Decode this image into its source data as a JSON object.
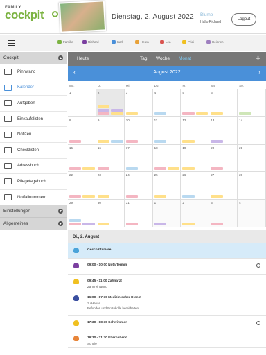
{
  "header": {
    "logo_line1": "FAMILY",
    "logo_line2": "cockpit",
    "date": "Dienstag, 2. August 2022",
    "user_name": "Blume",
    "greeting": "Hallo Richard",
    "logout_label": "Logout"
  },
  "members": [
    {
      "name": "Familie",
      "color": "#7cb342"
    },
    {
      "name": "Richard",
      "color": "#7b3fa0"
    },
    {
      "name": "Karl",
      "color": "#4a90d9"
    },
    {
      "name": "Helen",
      "color": "#e8a23a"
    },
    {
      "name": "Lea",
      "color": "#d9534f"
    },
    {
      "name": "Pridi",
      "color": "#f0c020"
    },
    {
      "name": "Heinrich",
      "color": "#9e7fbf"
    }
  ],
  "sidebar": {
    "section_cockpit": "Cockpit",
    "items": [
      {
        "label": "Pinnwand",
        "icon": "pinboard-icon"
      },
      {
        "label": "Kalender",
        "icon": "calendar-icon"
      },
      {
        "label": "Aufgaben",
        "icon": "tasks-icon"
      },
      {
        "label": "Einkaufslisten",
        "icon": "shopping-icon"
      },
      {
        "label": "Notizen",
        "icon": "notes-icon"
      },
      {
        "label": "Checklisten",
        "icon": "checklist-icon"
      },
      {
        "label": "Adressbuch",
        "icon": "addressbook-icon"
      },
      {
        "label": "Pflegetagebuch",
        "icon": "care-diary-icon"
      },
      {
        "label": "Notfallnummern",
        "icon": "emergency-icon"
      }
    ],
    "section_settings": "Einstellungen",
    "section_general": "Allgemeines"
  },
  "calendar": {
    "today_label": "Heute",
    "tabs": [
      "Tag",
      "Woche",
      "Monat"
    ],
    "active_tab": "Monat",
    "month_title": "August 2022",
    "weekdays": [
      "Mo.",
      "Di.",
      "Mi.",
      "Do.",
      "Fr.",
      "Sa.",
      "So."
    ],
    "weeks": [
      [
        "1",
        "2",
        "3",
        "4",
        "5",
        "6",
        "7"
      ],
      [
        "8",
        "9",
        "10",
        "11",
        "12",
        "13",
        "14"
      ],
      [
        "15",
        "16",
        "17",
        "18",
        "19",
        "20",
        "21"
      ],
      [
        "22",
        "23",
        "24",
        "25",
        "26",
        "27",
        "28"
      ],
      [
        "29",
        "30",
        "31",
        "1",
        "2",
        "3",
        "4"
      ]
    ]
  },
  "day": {
    "title": "Di., 2. August",
    "events": [
      {
        "title": "Geschäftsreise",
        "sub1": "",
        "sub2": "",
        "color": "#4aa3d9"
      },
      {
        "title": "09:00 - 10:00  Notartermin",
        "sub1": "",
        "sub2": "",
        "color": "#7b3fa0"
      },
      {
        "title": "09:45 - 11:00  Zahnarzt",
        "sub1": "Zahnreinigung",
        "sub2": "",
        "color": "#f0c020"
      },
      {
        "title": "16:00 - 17:30  Medizinischer Dienst",
        "sub1": "zu Hause",
        "sub2": "Befunden und Protokolle bereithalten",
        "color": "#3a4fa0"
      },
      {
        "title": "17:30 - 18:30  Schwimmen",
        "sub1": "",
        "sub2": "",
        "color": "#f0c020"
      },
      {
        "title": "19:30 - 21:30  Elternabend",
        "sub1": "Schule",
        "sub2": "",
        "color": "#e8853a"
      }
    ]
  }
}
